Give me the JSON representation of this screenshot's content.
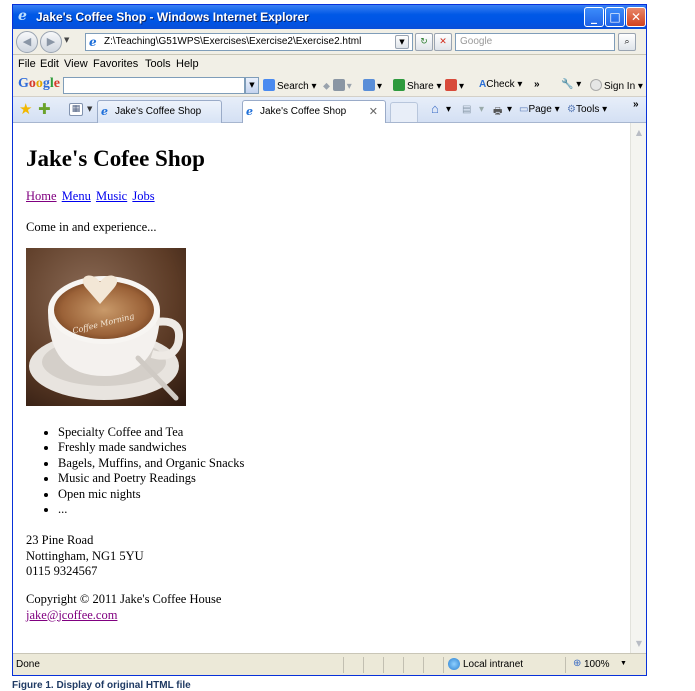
{
  "window": {
    "title": "Jake's Coffee Shop - Windows Internet Explorer",
    "title_icon": "ie-icon",
    "buttons": {
      "minimize": "_",
      "maximize": "□",
      "close": "✕"
    }
  },
  "address_bar": {
    "url": "Z:\\Teaching\\G51WPS\\Exercises\\Exercise2\\Exercise2.html",
    "search_placeholder": "Google",
    "back_icon": "◀",
    "forward_icon": "▶",
    "refresh_icon": "↻",
    "stop_icon": "✕",
    "search_icon": "⌕"
  },
  "menu": [
    "File",
    "Edit",
    "View",
    "Favorites",
    "Tools",
    "Help"
  ],
  "google_toolbar": {
    "logo": [
      "G",
      "o",
      "o",
      "g",
      "l",
      "e"
    ],
    "search_label": "Search",
    "share_label": "Share",
    "check_label": "Check",
    "more": "»",
    "signin_label": "Sign In"
  },
  "tabs": [
    {
      "label": "Jake's Coffee Shop"
    },
    {
      "label": "Jake's Coffee Shop",
      "close": "✕"
    }
  ],
  "command_bar": {
    "page_label": "Page",
    "tools_label": "Tools",
    "more": "»"
  },
  "page": {
    "heading": "Jake's Cofee Shop",
    "nav": [
      "Home",
      "Menu",
      "Music",
      "Jobs"
    ],
    "intro": "Come in and experience...",
    "image_text": "Coffee Morning",
    "features": [
      "Specialty Coffee and Tea",
      "Freshly made sandwiches",
      "Bagels, Muffins, and Organic Snacks",
      "Music and Poetry Readings",
      "Open mic nights",
      "..."
    ],
    "address": [
      "23 Pine Road",
      "Nottingham, NG1 5YU",
      "0115 9324567"
    ],
    "copyright": "Copyright © 2011 Jake's Coffee House",
    "email": "jake@jcoffee.com"
  },
  "status_bar": {
    "status": "Done",
    "zone": "Local intranet",
    "zoom": "100%"
  },
  "caption": "Figure 1. Display of original HTML file",
  "colors": {
    "titlebar": "#0058e6",
    "visited_link": "#800080",
    "link": "#0000ee"
  }
}
